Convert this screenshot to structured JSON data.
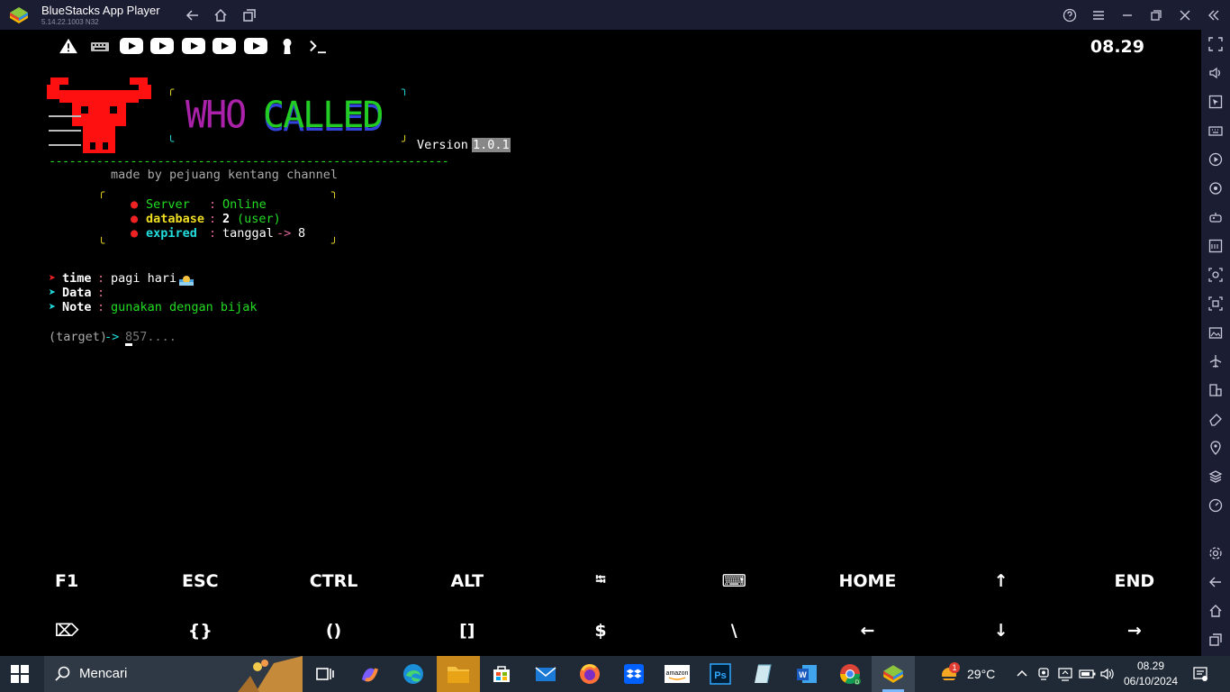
{
  "window": {
    "title": "BlueStacks App Player",
    "version": "5.14.22.1003 N32"
  },
  "statusbar": {
    "time": "08.29",
    "icons": [
      "warning-icon",
      "keyboard-icon",
      "youtube-icon",
      "youtube-icon",
      "youtube-icon",
      "youtube-icon",
      "youtube-icon",
      "keyhole-icon",
      "terminal-icon"
    ]
  },
  "terminal": {
    "banner_left": "WHO",
    "banner_right": "CALLED",
    "version_label": "Version",
    "version_value": "1.0.1",
    "divider": "-----------------------------------------------------------",
    "credit": "made by pejuang kentang channel",
    "server_label": "Server",
    "server_sep": ":",
    "server_value": "Online",
    "database_label": "database",
    "database_sep": ":",
    "database_value": "2",
    "database_unit": "(user)",
    "expired_label": "expired",
    "expired_sep": ":",
    "expired_value": "tanggal",
    "expired_arrow": "->",
    "expired_num": "8",
    "time_label": "time",
    "time_value": "pagi hari",
    "data_label": "Data",
    "note_label": "Note",
    "note_value": "gunakan dengan bijak",
    "prompt_label": "(target)",
    "prompt_arrow": "->",
    "prompt_placeholder": "857....",
    "colon": ":"
  },
  "extra_keys": {
    "row1": [
      "F1",
      "ESC",
      "CTRL",
      "ALT",
      "⭾",
      "⌨",
      "HOME",
      "↑",
      "END"
    ],
    "row2": [
      "⌦",
      "{}",
      "()",
      "[]",
      "$",
      "\\",
      "←",
      "↓",
      "→"
    ]
  },
  "taskbar": {
    "search_placeholder": "Mencari",
    "weather": "29°C",
    "weather_badge": "1",
    "clock_time": "08.29",
    "clock_date": "06/10/2024"
  },
  "colors": {
    "titlebar": "#1b1d33",
    "taskbar": "#1f2a36",
    "terminal_green": "#22dd22",
    "terminal_red": "#ee2222"
  }
}
